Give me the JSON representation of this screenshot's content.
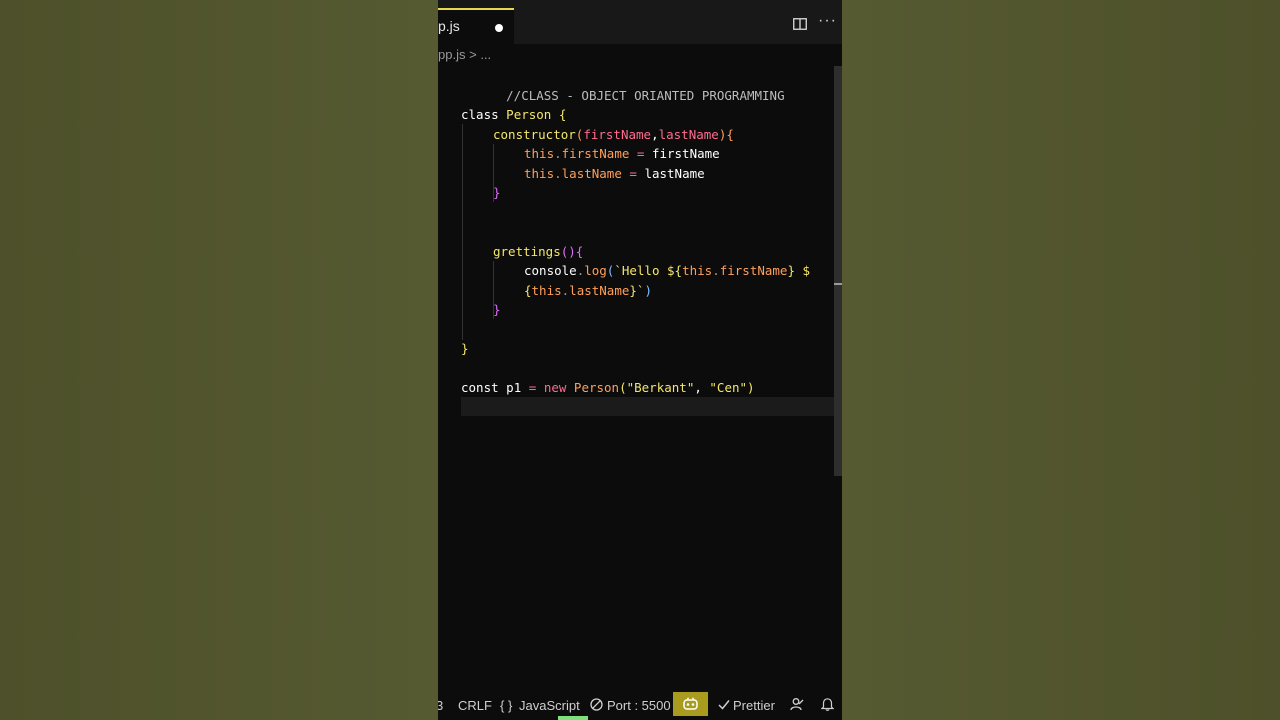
{
  "tab": {
    "label": "p.js"
  },
  "breadcrumb": {
    "file": "pp.js",
    "separator": ">",
    "ellipsis": "..."
  },
  "code": {
    "comment": "//CLASS - OBJECT ORIANTED PROGRAMMING",
    "l3_kw": "class",
    "l3_name": "Person",
    "l3_brace": "{",
    "l4_name": "constructor",
    "l4_open": "(",
    "l4_p1": "firstName",
    "l4_comma": ",",
    "l4_p2": "lastName",
    "l4_close": ")",
    "l4_brace": "{",
    "l5_this": "this",
    "l5_dot": ".",
    "l5_prop": "firstName",
    "l5_eq": " = ",
    "l5_val": "firstName",
    "l6_this": "this",
    "l6_dot": ".",
    "l6_prop": "lastName",
    "l6_eq": " = ",
    "l6_val": "lastName",
    "l7_brace": "}",
    "l10_name": "grettings",
    "l10_paren": "()",
    "l10_brace": "{",
    "l11_obj": "console",
    "l11_dot": ".",
    "l11_fn": "log",
    "l11_open": "(",
    "l11_str": "`Hello ",
    "l11_t1": "${",
    "l11_this": "this",
    "l11_dot2": ".",
    "l11_prop": "firstName",
    "l11_t2": "}",
    "l11_sp": " ",
    "l11_dollar": "$",
    "l12_open": "{",
    "l12_this": "this",
    "l12_dot": ".",
    "l12_prop": "lastName",
    "l12_close": "}",
    "l12_tick": "`",
    "l12_paren": ")",
    "l13_brace": "}",
    "l15_brace": "}",
    "l17_kw": "const",
    "l17_var": "p1",
    "l17_eq": " = ",
    "l17_new": "new",
    "l17_cls": "Person",
    "l17_open": "(",
    "l17_s1": "\"Berkant\"",
    "l17_comma": ", ",
    "l17_s2": "\"Cen\"",
    "l17_close": ")"
  },
  "status": {
    "partial": "3",
    "eol": "CRLF",
    "lang_icon": "{ }",
    "language": "JavaScript",
    "port": "Port : 5500",
    "prettier": "Prettier"
  },
  "icons": {
    "split": "split-editor-icon",
    "more": "more-actions-icon",
    "port": "no-entry-icon",
    "copilot": "copilot-icon",
    "check": "check-icon",
    "person": "accounts-icon",
    "bell": "bell-icon"
  },
  "colors": {
    "tab_accent": "#e8d84a",
    "keyword": "#ff6b8e",
    "string": "#f5e76b",
    "copilot": "#a89b1e"
  }
}
